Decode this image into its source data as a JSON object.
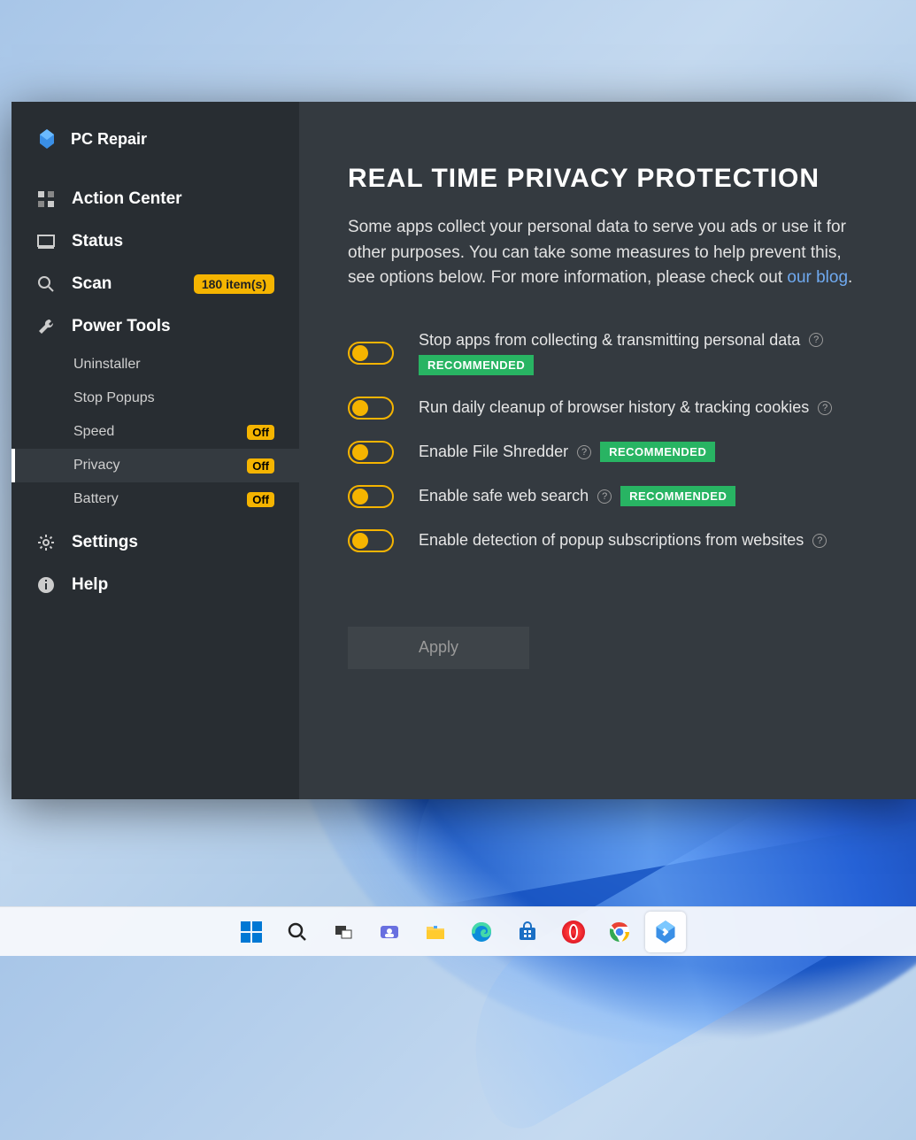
{
  "app": {
    "title": "PC Repair"
  },
  "sidebar": {
    "items": [
      {
        "label": "Action Center",
        "icon": "grid-icon"
      },
      {
        "label": "Status",
        "icon": "monitor-icon"
      },
      {
        "label": "Scan",
        "icon": "search-icon",
        "badge": "180 item(s)"
      },
      {
        "label": "Power Tools",
        "icon": "wrench-icon"
      },
      {
        "label": "Settings",
        "icon": "gear-icon"
      },
      {
        "label": "Help",
        "icon": "info-icon"
      }
    ],
    "subitems": [
      {
        "label": "Uninstaller",
        "chip": ""
      },
      {
        "label": "Stop Popups",
        "chip": ""
      },
      {
        "label": "Speed",
        "chip": "Off"
      },
      {
        "label": "Privacy",
        "chip": "Off",
        "active": true
      },
      {
        "label": "Battery",
        "chip": "Off"
      }
    ]
  },
  "main": {
    "heading": "REAL TIME PRIVACY PROTECTION",
    "intro_prefix": "Some apps collect your personal data to serve you ads or use it for other purposes. You can take some measures to help prevent this, see options below. For more information, please check out ",
    "intro_link": "our blog",
    "intro_suffix": ".",
    "options": [
      {
        "label": "Stop apps from collecting & transmitting personal data",
        "recommended": "RECOMMENDED",
        "rec_below": true
      },
      {
        "label": "Run daily cleanup of browser history & tracking cookies",
        "recommended": ""
      },
      {
        "label": "Enable File Shredder",
        "recommended": "RECOMMENDED"
      },
      {
        "label": "Enable safe web search",
        "recommended": "RECOMMENDED"
      },
      {
        "label": "Enable detection of popup subscriptions from websites",
        "recommended": ""
      }
    ],
    "apply_label": "Apply"
  },
  "taskbar": {
    "items": [
      {
        "name": "start-button"
      },
      {
        "name": "search-button"
      },
      {
        "name": "task-view-button"
      },
      {
        "name": "teams-icon"
      },
      {
        "name": "file-explorer-icon"
      },
      {
        "name": "edge-icon"
      },
      {
        "name": "store-icon"
      },
      {
        "name": "opera-icon"
      },
      {
        "name": "chrome-icon"
      },
      {
        "name": "pc-repair-icon",
        "active": true
      }
    ]
  }
}
